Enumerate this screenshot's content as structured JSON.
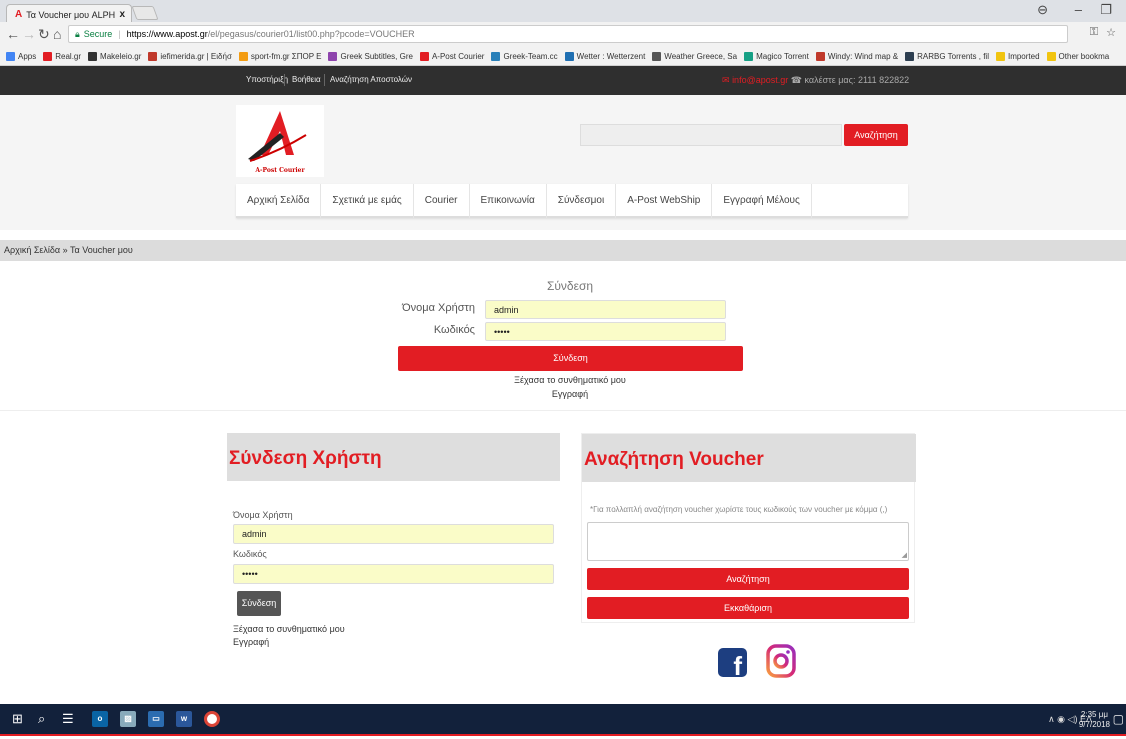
{
  "browser": {
    "tab_title": "Τα Voucher μου ALPHA F",
    "tab_close": "x",
    "secure_label": "Secure",
    "url_host": "https://www.apost.gr",
    "url_path": "/el/pegasus/courier01/list00.php?pcode=VOUCHER",
    "bookmarks": [
      {
        "label": "Apps",
        "color": "#4285f4"
      },
      {
        "label": "Real.gr",
        "color": "#e21d23"
      },
      {
        "label": "Makeleio.gr",
        "color": "#333333"
      },
      {
        "label": "iefimerida.gr | Ειδήσ",
        "color": "#c0392b"
      },
      {
        "label": "sport-fm.gr ΣΠΟΡ Ε",
        "color": "#f39c12"
      },
      {
        "label": "Greek Subtitles, Gre",
        "color": "#8e44ad"
      },
      {
        "label": "A-Post Courier",
        "color": "#e21d23"
      },
      {
        "label": "Greek-Team.cc",
        "color": "#2980b9"
      },
      {
        "label": "Wetter : Wetterzent",
        "color": "#1f6fb2"
      },
      {
        "label": "Weather Greece, Sa",
        "color": "#555555"
      },
      {
        "label": "Magico Torrent",
        "color": "#16a085"
      },
      {
        "label": "Windy: Wind map &",
        "color": "#c0392b"
      },
      {
        "label": "RARBG Torrents , fil",
        "color": "#2c3e50"
      },
      {
        "label": "Imported",
        "color": "#f1c40f"
      },
      {
        "label": "Other bookma",
        "color": "#f1c40f"
      }
    ]
  },
  "site": {
    "top_links": [
      "Υποστήριξη",
      "Βοήθεια",
      "Αναζήτηση Αποστολών"
    ],
    "contact_email": "info@apost.gr",
    "contact_phone": "καλέστε μας: 2111 822822",
    "logo_caption": "A-Post Courier",
    "search_button": "Αναζήτηση",
    "nav": [
      "Αρχική Σελίδα",
      "Σχετικά με εμάς",
      "Courier",
      "Επικοινωνία",
      "Σύνδεσμοι",
      "A-Post WebShip",
      "Εγγραφή Μέλους"
    ],
    "breadcrumb": "Αρχική Σελίδα » Τα Voucher μου"
  },
  "login_top": {
    "title": "Σύνδεση",
    "username_label": "Όνομα Χρήστη",
    "username_value": "admin",
    "password_label": "Κωδικός",
    "password_value": "•••••",
    "submit": "Σύνδεση",
    "forgot": "Ξέχασα το συνθηματικό μου",
    "register": "Εγγραφή"
  },
  "login_panel": {
    "title": "Σύνδεση Χρήστη",
    "username_label": "Όνομα Χρήστη",
    "username_value": "admin",
    "password_label": "Κωδικός",
    "password_value": "•••••",
    "submit": "Σύνδεση",
    "forgot": "Ξέχασα το συνθηματικό μου",
    "register": "Εγγραφή"
  },
  "voucher_panel": {
    "title": "Αναζήτηση Voucher",
    "note": "*Για πολλαπλή αναζήτηση voucher χωρίστε τους κωδικούς των voucher με κόμμα (,)",
    "search": "Αναζήτηση",
    "clear": "Εκκαθάριση"
  },
  "taskbar": {
    "tray_text": "ΕΛ",
    "clock_time": "2:35 μμ",
    "clock_date": "9/7/2018"
  },
  "colors": {
    "brand_red": "#e21d23",
    "topbar_dark": "#2f2f2f",
    "taskbar": "#12213b"
  }
}
